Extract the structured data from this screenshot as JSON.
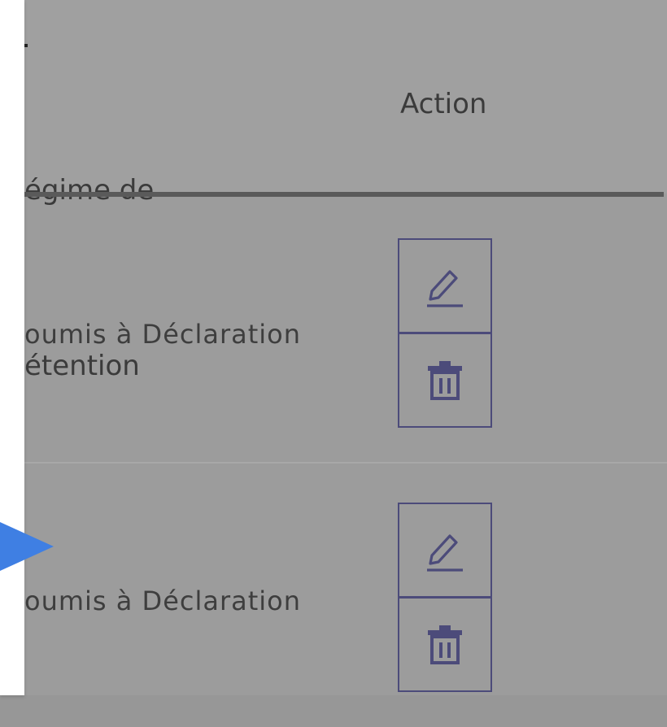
{
  "table": {
    "headers": {
      "regime_line1": "égime de",
      "regime_line2": "étention",
      "action": "Action"
    },
    "rows": [
      {
        "regime": "oumis à Déclaration"
      },
      {
        "regime": "oumis à Déclaration"
      }
    ]
  },
  "colors": {
    "accent": "#3f7fe3",
    "action_border": "#4c4b7a",
    "backdrop": "#9c9c9c"
  },
  "icons": {
    "edit": "pencil-icon",
    "delete": "trash-icon",
    "pointer": "arrow-right-icon"
  }
}
